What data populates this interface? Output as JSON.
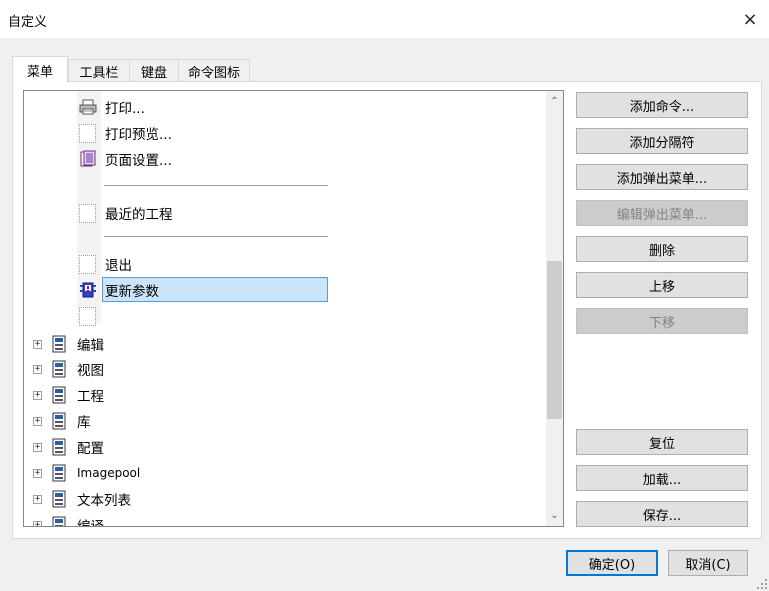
{
  "window": {
    "title": "自定义",
    "close_label": "×"
  },
  "tabs": [
    {
      "label": "菜单",
      "active": true
    },
    {
      "label": "工具栏",
      "active": false
    },
    {
      "label": "键盘",
      "active": false
    },
    {
      "label": "命令图标",
      "active": false
    }
  ],
  "menu_items": [
    {
      "label": "打印...",
      "icon": "printer-icon"
    },
    {
      "label": "打印预览...",
      "icon": "empty-slot-icon"
    },
    {
      "label": "页面设置...",
      "icon": "page-setup-icon"
    },
    {
      "label": "最近的工程",
      "icon": "empty-slot-icon"
    },
    {
      "label": "退出",
      "icon": "empty-slot-icon"
    },
    {
      "label": "更新参数",
      "icon": "update-parameters-icon",
      "selected": true
    }
  ],
  "menu_groups": [
    {
      "label": "编辑",
      "expander": "+"
    },
    {
      "label": "视图",
      "expander": "+"
    },
    {
      "label": "工程",
      "expander": "+"
    },
    {
      "label": "库",
      "expander": "+"
    },
    {
      "label": "配置",
      "expander": "+"
    },
    {
      "label": "Imagepool",
      "expander": "+"
    },
    {
      "label": "文本列表",
      "expander": "+"
    },
    {
      "label": "编译",
      "expander": "+"
    }
  ],
  "scrollbar": {
    "up_arrow": "⌃",
    "down_arrow": "⌄"
  },
  "buttons": {
    "add_command": "添加命令...",
    "add_separator": "添加分隔符",
    "add_popup": "添加弹出菜单...",
    "edit_popup": "编辑弹出菜单...",
    "delete": "删除",
    "move_up": "上移",
    "move_down": "下移",
    "reset": "复位",
    "load": "加载...",
    "save": "保存..."
  },
  "dialog_buttons": {
    "ok": "确定(O)",
    "cancel": "取消(C)"
  }
}
